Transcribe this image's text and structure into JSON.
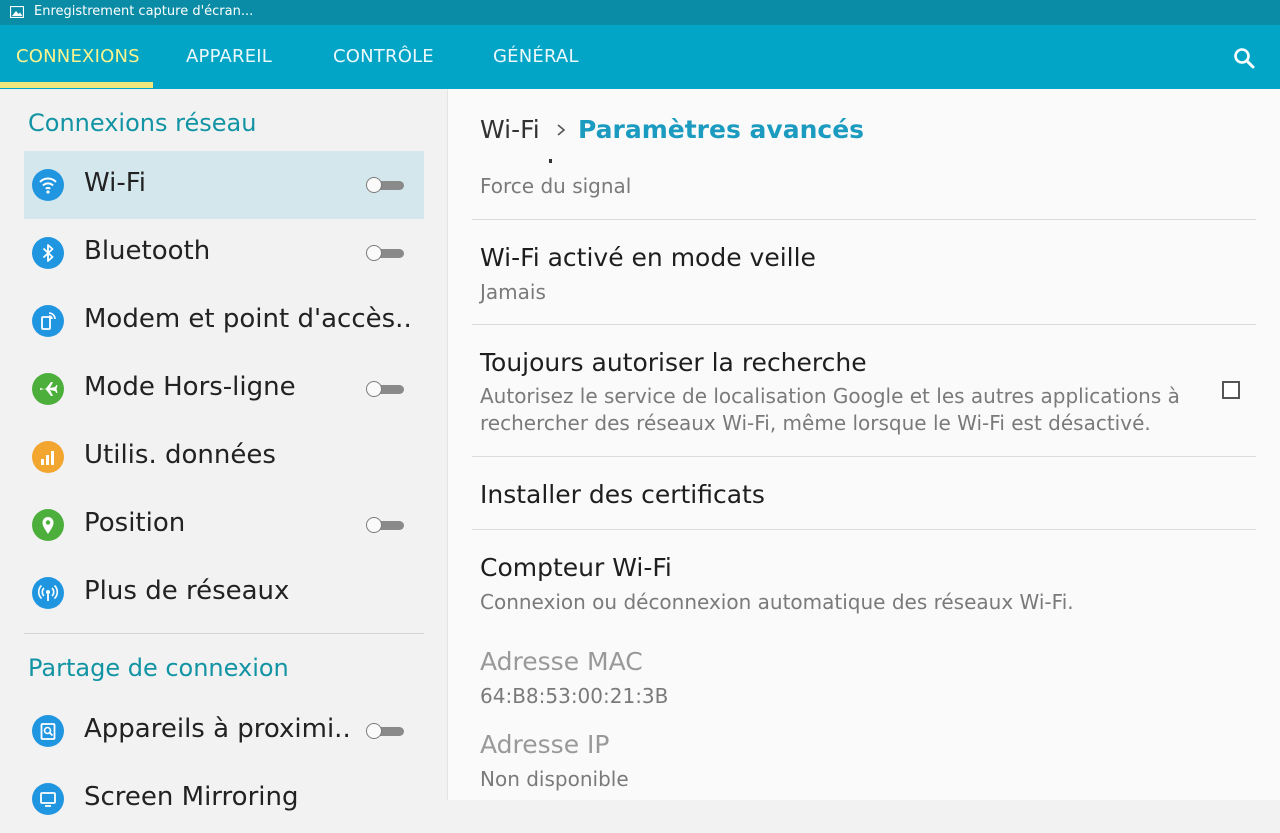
{
  "status_bar": {
    "notification_icon": "image-icon",
    "text": "Enregistrement capture d'écran..."
  },
  "tabs": [
    {
      "label": "CONNEXIONS",
      "active": true
    },
    {
      "label": "APPAREIL",
      "active": false
    },
    {
      "label": "CONTRÔLE",
      "active": false
    },
    {
      "label": "GÉNÉRAL",
      "active": false
    }
  ],
  "search_icon": "search-icon",
  "colors": {
    "tabbar": "#02a5c6",
    "accent": "#1294a4",
    "active_tab": "#fbf38e"
  },
  "sidebar": {
    "sections": [
      {
        "title": "Connexions réseau",
        "items": [
          {
            "label": "Wi-Fi",
            "icon": "wifi-icon",
            "toggle": false,
            "selected": true
          },
          {
            "label": "Bluetooth",
            "icon": "bluetooth-icon",
            "toggle": false
          },
          {
            "label": "Modem et point d'accès..",
            "icon": "hotspot-icon"
          },
          {
            "label": "Mode Hors-ligne",
            "icon": "airplane-icon",
            "toggle": false
          },
          {
            "label": "Utilis. données",
            "icon": "data-usage-icon"
          },
          {
            "label": "Position",
            "icon": "location-icon",
            "toggle": false
          },
          {
            "label": "Plus de réseaux",
            "icon": "more-networks-icon"
          }
        ]
      },
      {
        "title": "Partage de connexion",
        "items": [
          {
            "label": "Appareils à proximi..",
            "icon": "nearby-devices-icon",
            "toggle": false
          },
          {
            "label": "Screen Mirroring",
            "icon": "screen-mirroring-icon"
          }
        ]
      }
    ]
  },
  "detail": {
    "breadcrumb": {
      "parent": "Wi-Fi",
      "current": "Paramètres avancés"
    },
    "rows": [
      {
        "subtitle": "Force du signal"
      },
      {
        "title": "Wi-Fi activé en mode veille",
        "subtitle": "Jamais"
      },
      {
        "title": "Toujours autoriser la recherche",
        "subtitle": "Autorisez le service de localisation Google et les autres applications à rechercher des réseaux Wi-Fi, même lorsque le Wi-Fi est désactivé.",
        "checked": false
      },
      {
        "title": "Installer des certificats"
      },
      {
        "title": "Compteur Wi-Fi",
        "subtitle": "Connexion ou déconnexion automatique des réseaux Wi-Fi."
      },
      {
        "title": "Adresse MAC",
        "subtitle": "64:B8:53:00:21:3B",
        "disabled": true
      },
      {
        "title": "Adresse IP",
        "subtitle": "Non disponible",
        "disabled": true
      }
    ]
  }
}
